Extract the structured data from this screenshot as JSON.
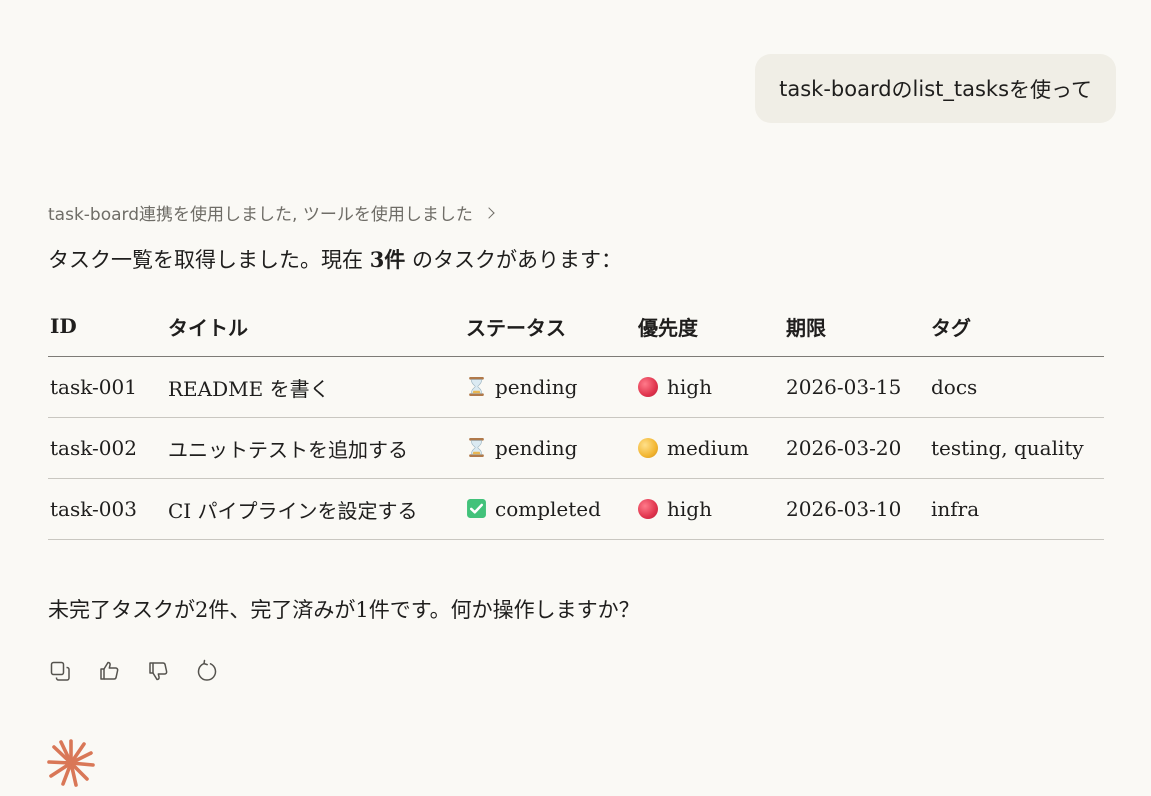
{
  "user_message": {
    "prefix": "task-board",
    "part1": " の ",
    "tool": "list_tasks",
    "suffix": " を使って"
  },
  "tool_summary": "task-board連携を使用しました, ツールを使用しました",
  "intro": {
    "before": "タスク一覧を取得しました。現在 ",
    "count": "3件",
    "after": " のタスクがあります："
  },
  "table": {
    "headers": [
      "ID",
      "タイトル",
      "ステータス",
      "優先度",
      "期限",
      "タグ"
    ],
    "rows": [
      {
        "id": "task-001",
        "title": "README を書く",
        "status": "pending",
        "status_icon": "hourglass-icon",
        "priority": "high",
        "priority_icon": "red-circle-icon",
        "due": "2026-03-15",
        "tags": "docs"
      },
      {
        "id": "task-002",
        "title": "ユニットテストを追加する",
        "status": "pending",
        "status_icon": "hourglass-icon",
        "priority": "medium",
        "priority_icon": "yellow-circle-icon",
        "due": "2026-03-20",
        "tags": "testing, quality"
      },
      {
        "id": "task-003",
        "title": "CI パイプラインを設定する",
        "status": "completed",
        "status_icon": "check-mark-icon",
        "priority": "high",
        "priority_icon": "red-circle-icon",
        "due": "2026-03-10",
        "tags": "infra"
      }
    ]
  },
  "outro": "未完了タスクが2件、完了済みが1件です。何か操作しますか？",
  "actions": [
    "copy-icon",
    "thumbs-up-icon",
    "thumbs-down-icon",
    "retry-icon"
  ],
  "colors": {
    "background": "#faf9f5",
    "user_bubble": "#f0eee6",
    "text": "#1f1e1d",
    "muted": "#6f6d67",
    "brand_logo": "#d97757",
    "priority_high": "#e0344d",
    "priority_medium": "#f2b632",
    "completed_check": "#42c27a"
  }
}
